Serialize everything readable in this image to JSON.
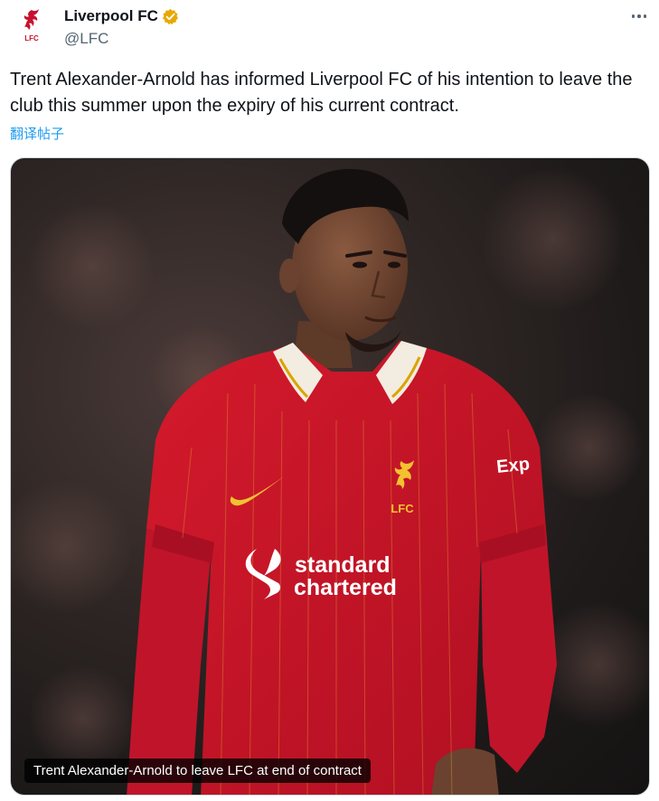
{
  "account": {
    "display_name": "Liverpool FC",
    "handle": "@LFC",
    "verified": true,
    "verified_color": "#e8a800",
    "avatar_icon": "lfc-crest-icon",
    "crest_text": "LFC"
  },
  "post": {
    "text": "Trent Alexander-Arnold has informed Liverpool FC of his intention to leave the club this summer upon the expiry of his current contract.",
    "translate_label": "翻译帖子",
    "more_icon": "more-dots-icon"
  },
  "media": {
    "caption": "Trent Alexander-Arnold to leave LFC at end of contract",
    "kit_color": "#c8102e",
    "jersey_texts": {
      "sponsor_line1": "standard",
      "sponsor_line2": "chartered",
      "crest": "LFC",
      "sleeve": "Exp"
    }
  },
  "colors": {
    "link": "#1d9bf0",
    "secondary_text": "#536471",
    "primary_text": "#0f1419"
  }
}
